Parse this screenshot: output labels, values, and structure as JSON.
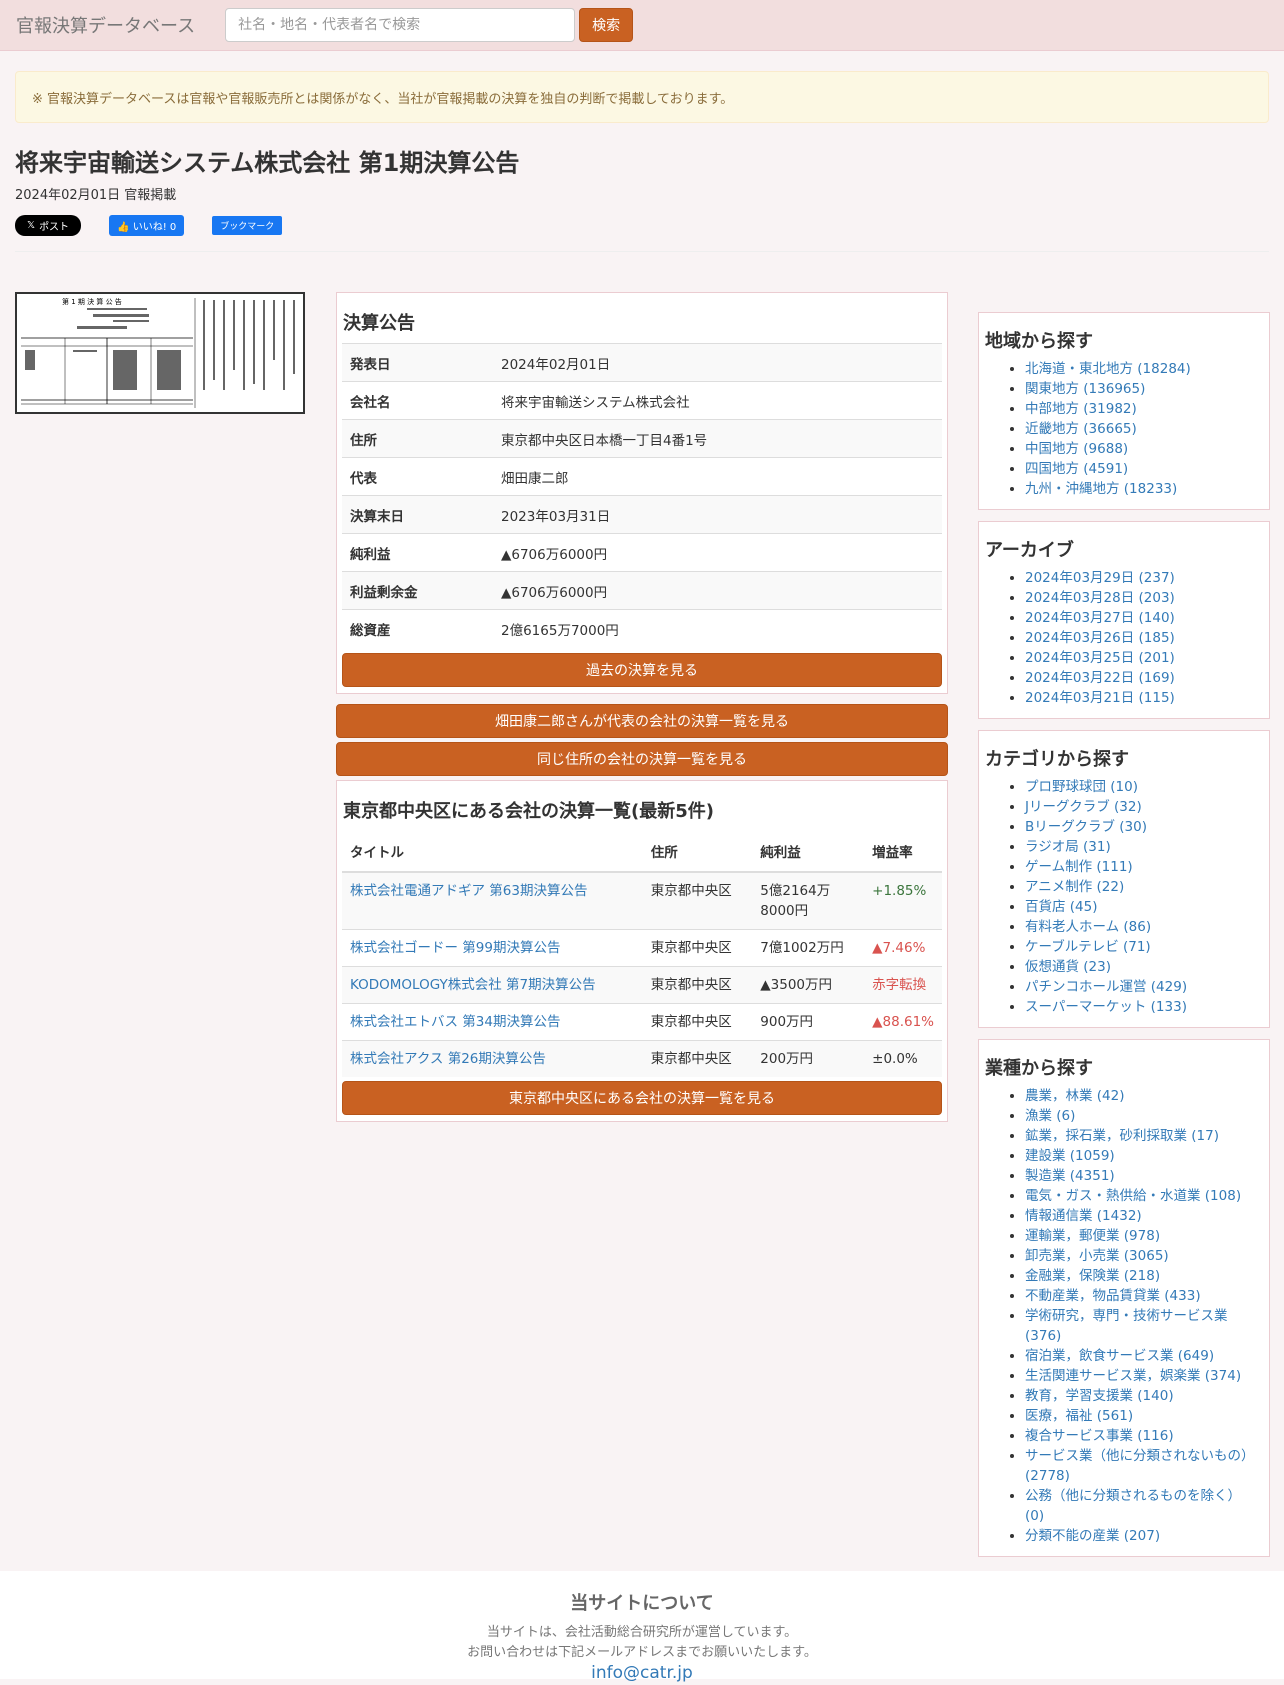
{
  "navbar": {
    "brand": "官報決算データベース",
    "search_placeholder": "社名・地名・代表者名で検索",
    "search_button": "検索"
  },
  "notice": "※ 官報決算データベースは官報や官報販売所とは関係がなく、当社が官報掲載の決算を独自の判断で掲載しております。",
  "page": {
    "title": "将来宇宙輸送システム株式会社 第1期決算公告",
    "date": "2024年02月01日 官報掲載"
  },
  "share": {
    "x_label": "ポスト",
    "fb_label": "いいね! 0",
    "hatena_label": "ブックマーク"
  },
  "report": {
    "heading": "決算公告",
    "rows": [
      {
        "k": "発表日",
        "v": "2024年02月01日"
      },
      {
        "k": "会社名",
        "v": "将来宇宙輸送システム株式会社"
      },
      {
        "k": "住所",
        "v": "東京都中央区日本橋一丁目4番1号"
      },
      {
        "k": "代表",
        "v": "畑田康二郎"
      },
      {
        "k": "決算末日",
        "v": "2023年03月31日"
      },
      {
        "k": "純利益",
        "v": "▲6706万6000円"
      },
      {
        "k": "利益剰余金",
        "v": "▲6706万6000円"
      },
      {
        "k": "総資産",
        "v": "2億6165万7000円"
      }
    ],
    "past_button": "過去の決算を見る"
  },
  "buttons": {
    "representative": "畑田康二郎さんが代表の会社の決算一覧を見る",
    "same_address": "同じ住所の会社の決算一覧を見る"
  },
  "area_list": {
    "heading": "東京都中央区にある会社の決算一覧(最新5件)",
    "columns": [
      "タイトル",
      "住所",
      "純利益",
      "増益率"
    ],
    "rows": [
      {
        "title": "株式会社電通アドギア 第63期決算公告",
        "address": "東京都中央区",
        "profit": "5億2164万8000円",
        "rate": "+1.85%",
        "tone": "green"
      },
      {
        "title": "株式会社ゴードー 第99期決算公告",
        "address": "東京都中央区",
        "profit": "7億1002万円",
        "rate": "▲7.46%",
        "tone": "red"
      },
      {
        "title": "KODOMOLOGY株式会社 第7期決算公告",
        "address": "東京都中央区",
        "profit": "▲3500万円",
        "rate": "赤字転換",
        "tone": "red"
      },
      {
        "title": "株式会社エトバス 第34期決算公告",
        "address": "東京都中央区",
        "profit": "900万円",
        "rate": "▲88.61%",
        "tone": "red"
      },
      {
        "title": "株式会社アクス 第26期決算公告",
        "address": "東京都中央区",
        "profit": "200万円",
        "rate": "±0.0%",
        "tone": "plain"
      }
    ],
    "more_button": "東京都中央区にある会社の決算一覧を見る"
  },
  "sidebar": {
    "regions": {
      "heading": "地域から探す",
      "items": [
        "北海道・東北地方 (18284)",
        "関東地方 (136965)",
        "中部地方 (31982)",
        "近畿地方 (36665)",
        "中国地方 (9688)",
        "四国地方 (4591)",
        "九州・沖縄地方 (18233)"
      ]
    },
    "archive": {
      "heading": "アーカイブ",
      "items": [
        "2024年03月29日 (237)",
        "2024年03月28日 (203)",
        "2024年03月27日 (140)",
        "2024年03月26日 (185)",
        "2024年03月25日 (201)",
        "2024年03月22日 (169)",
        "2024年03月21日 (115)"
      ]
    },
    "categories": {
      "heading": "カテゴリから探す",
      "items": [
        "プロ野球球団 (10)",
        "Jリーグクラブ (32)",
        "Bリーグクラブ (30)",
        "ラジオ局 (31)",
        "ゲーム制作 (111)",
        "アニメ制作 (22)",
        "百貨店 (45)",
        "有料老人ホーム (86)",
        "ケーブルテレビ (71)",
        "仮想通貨 (23)",
        "パチンコホール運営 (429)",
        "スーパーマーケット (133)"
      ]
    },
    "industries": {
      "heading": "業種から探す",
      "items": [
        "農業，林業 (42)",
        "漁業 (6)",
        "鉱業，採石業，砂利採取業 (17)",
        "建設業 (1059)",
        "製造業 (4351)",
        "電気・ガス・熱供給・水道業 (108)",
        "情報通信業 (1432)",
        "運輸業，郵便業 (978)",
        "卸売業，小売業 (3065)",
        "金融業，保険業 (218)",
        "不動産業，物品賃貸業 (433)",
        "学術研究，専門・技術サービス業 (376)",
        "宿泊業，飲食サービス業 (649)",
        "生活関連サービス業，娯楽業 (374)",
        "教育，学習支援業 (140)",
        "医療，福祉 (561)",
        "複合サービス事業 (116)",
        "サービス業（他に分類されないもの） (2778)",
        "公務（他に分類されるものを除く） (0)",
        "分類不能の産業 (207)"
      ]
    }
  },
  "footer": {
    "heading": "当サイトについて",
    "line1": "当サイトは、会社活動総合研究所が運営しています。",
    "line2": "お問い合わせは下記メールアドレスまでお願いいたします。",
    "email": "info@catr.jp"
  }
}
